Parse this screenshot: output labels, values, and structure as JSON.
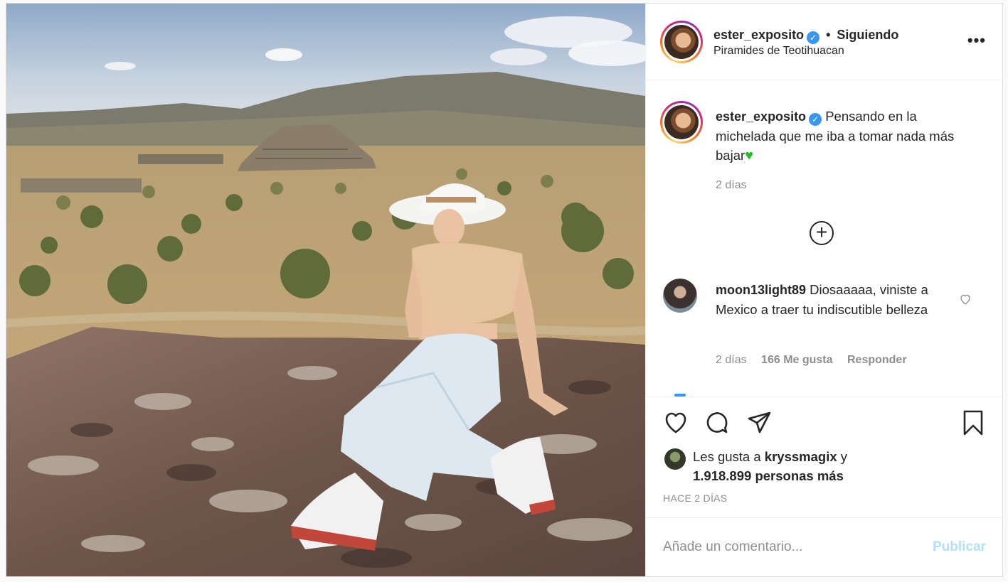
{
  "post": {
    "photo": {
      "icon": "photo-teotihuacan"
    },
    "header": {
      "username": "ester_exposito",
      "verified_icon": "verified-badge-icon",
      "separator": "•",
      "follow_status": "Siguiendo",
      "location": "Piramides de Teotihuacan",
      "more_icon": "more-options-icon",
      "more_label": "•••"
    },
    "caption": {
      "username": "ester_exposito",
      "text": "Pensando en la michelada que me iba a tomar nada más bajar",
      "emoji": "♥",
      "time": "2 días"
    },
    "load_more_label": "+",
    "comment": {
      "username": "moon13light89",
      "text": "Diosaaaaa, viniste a Mexico a traer tu indiscutible belleza",
      "time": "2 días",
      "likes": "166 Me gusta",
      "reply": "Responder"
    },
    "actions": {
      "like_icon": "heart-icon",
      "comment_icon": "comment-icon",
      "share_icon": "send-icon",
      "save_icon": "bookmark-icon"
    },
    "likes": {
      "prefix": "Les gusta a",
      "user": "kryssmagix",
      "connector": "y",
      "count": "1.918.899 personas más"
    },
    "timestamp": "HACE 2 DÍAS",
    "add_comment": {
      "placeholder": "Añade un comentario...",
      "publish": "Publicar"
    },
    "colors": {
      "accent": "#3897f0",
      "publish_disabled": "#b2dffc",
      "text": "#262626",
      "secondary": "#8e8e8e"
    }
  }
}
